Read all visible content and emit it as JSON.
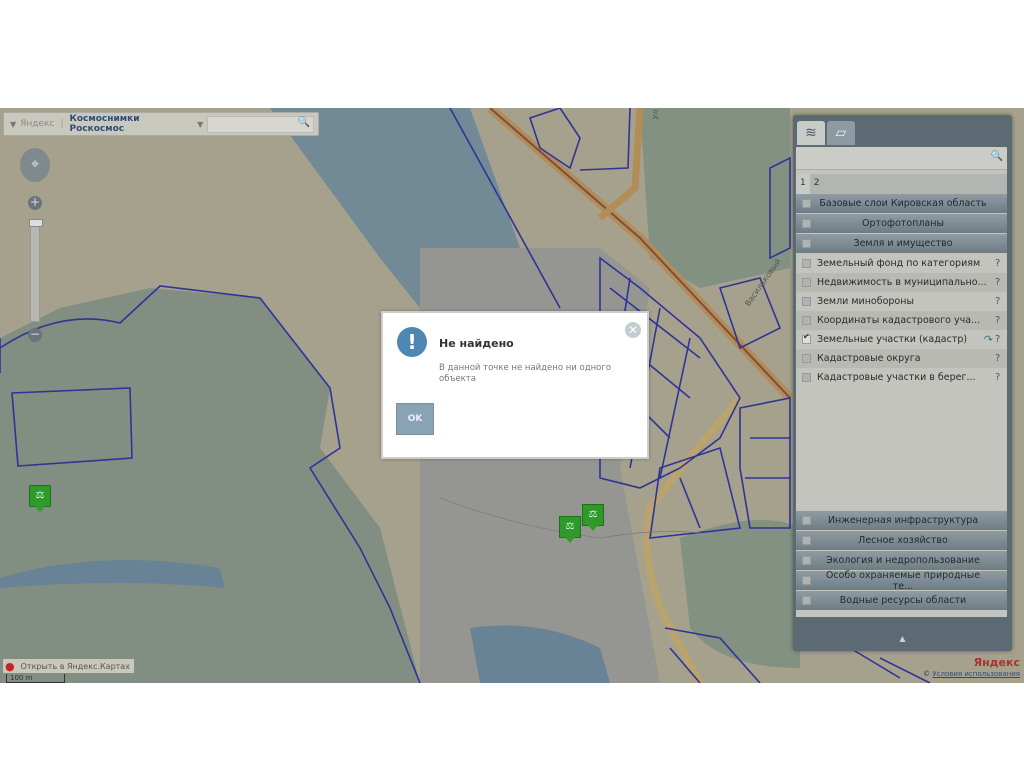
{
  "topbar": {
    "provider": "Яндекс",
    "layer": "Космоснимки Роскосмос",
    "search_placeholder": ""
  },
  "map": {
    "labels": [
      "ул",
      "Васильковый"
    ],
    "open_link": "Открыть в Яндекс.Картах",
    "scale": "100 m",
    "logo": "Яндекс",
    "terms": "Условия использования"
  },
  "panel": {
    "tab_numbers": [
      "1",
      "2"
    ],
    "categories_top": [
      {
        "label": "Базовые слои Кировская область"
      },
      {
        "label": "Ортофотопланы"
      },
      {
        "label": "Земля и имущество"
      }
    ],
    "items": [
      {
        "label": "Земельный фонд по категориям",
        "checked": false,
        "help": "?"
      },
      {
        "label": "Недвижимость в муниципально...",
        "checked": false,
        "help": "?"
      },
      {
        "label": "Земли минобороны",
        "checked": false,
        "help": "?"
      },
      {
        "label": "Координаты кадастрового уча...",
        "checked": false,
        "help": "?"
      },
      {
        "label": "Земельные участки (кадастр)",
        "checked": true,
        "help": "?"
      },
      {
        "label": "Кадастровые округа",
        "checked": false,
        "help": "?"
      },
      {
        "label": "Кадастровые участки в берег...",
        "checked": false,
        "help": "?"
      }
    ],
    "categories_bottom": [
      {
        "label": "Инженерная инфраструктура"
      },
      {
        "label": "Лесное хозяйство"
      },
      {
        "label": "Экология и недропользование"
      },
      {
        "label": "Особо охраняемые природные те..."
      },
      {
        "label": "Водные ресурсы области"
      }
    ]
  },
  "dialog": {
    "title": "Не найдено",
    "message": "В данной точке не найдено ни одного объекта",
    "ok_label": "OK"
  }
}
